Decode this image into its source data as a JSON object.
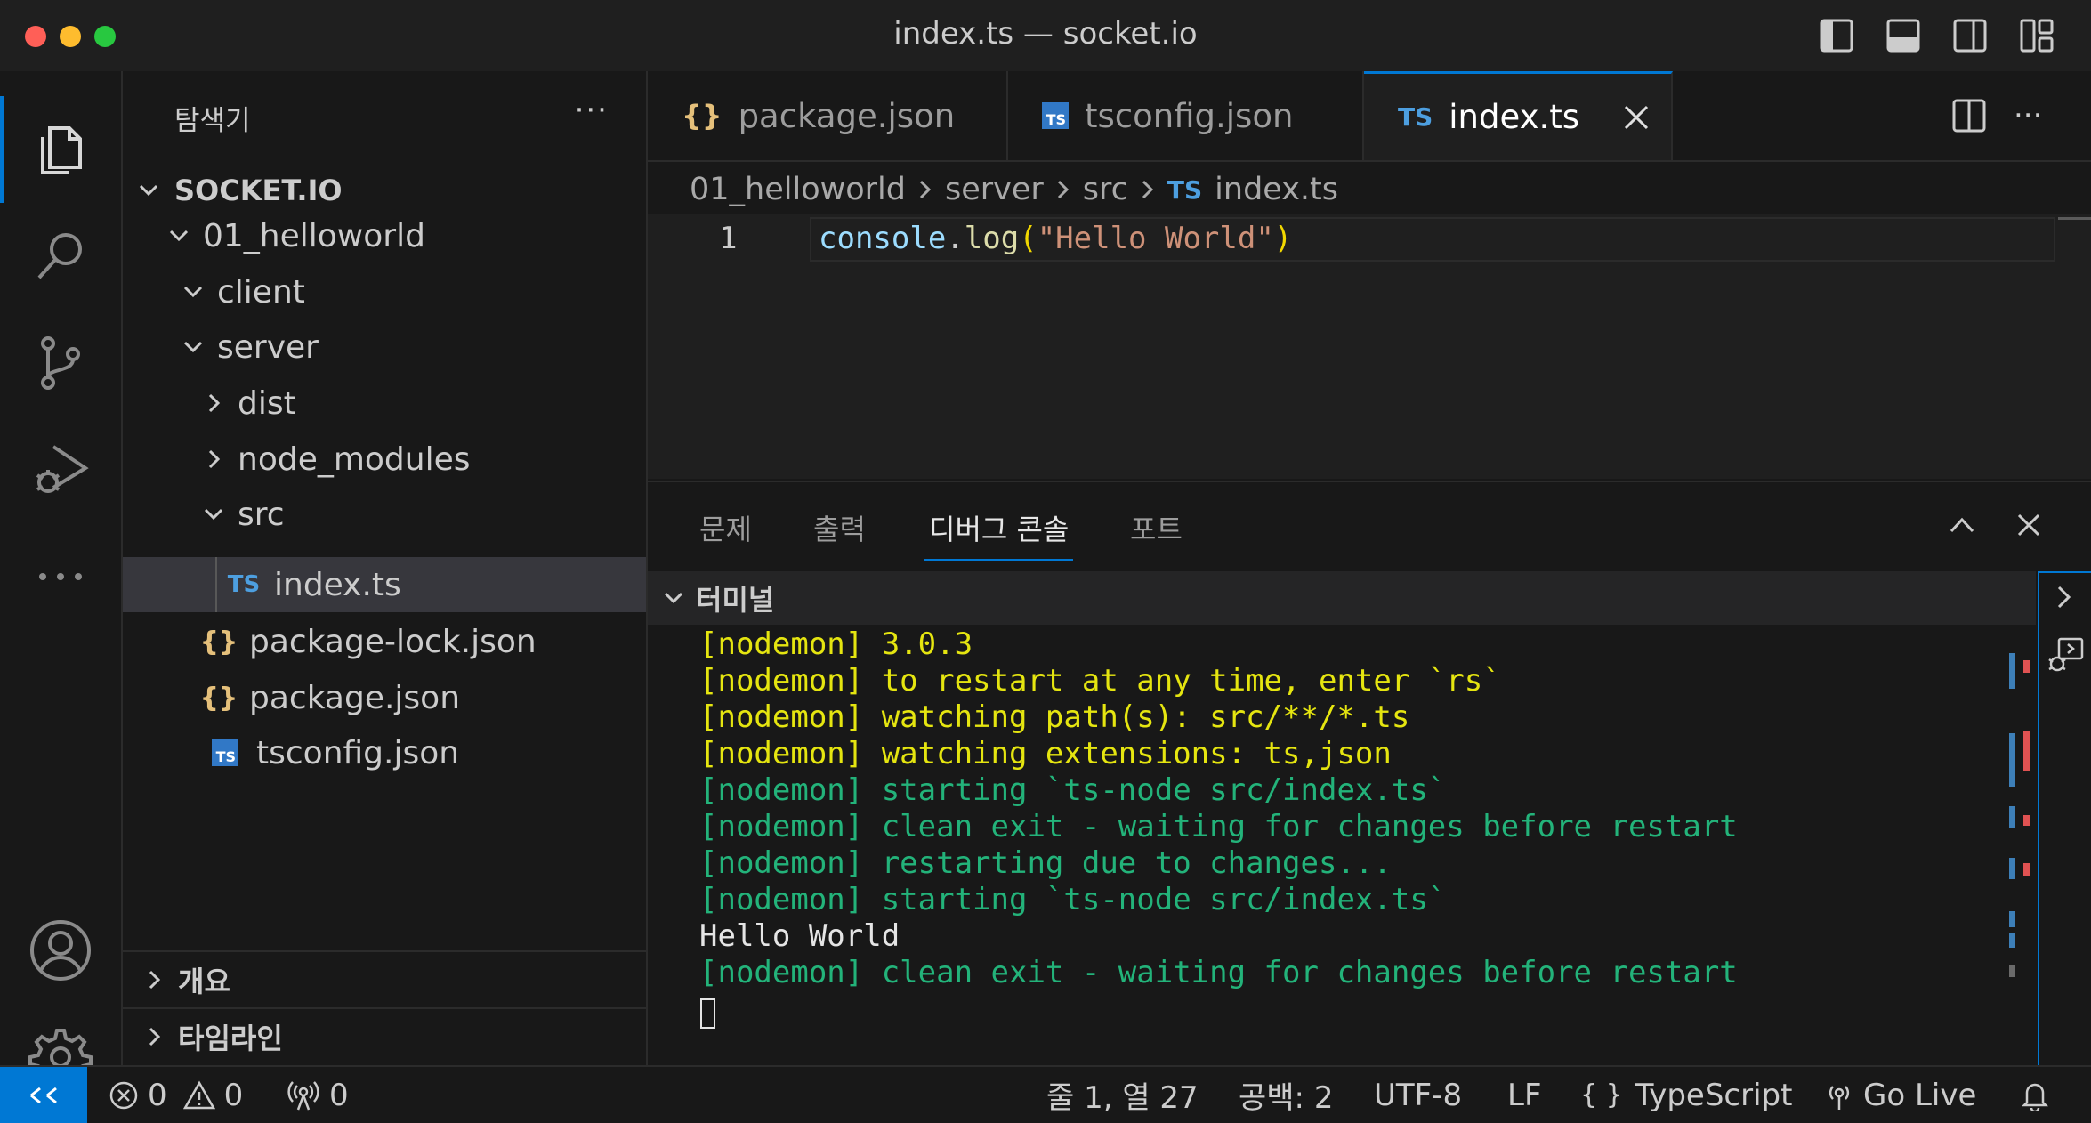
{
  "window": {
    "title": "index.ts — socket.io"
  },
  "sidebar": {
    "title": "탐색기",
    "more_label": "···",
    "root": "SOCKET.IO",
    "tree": [
      {
        "label": "01_helloworld",
        "kind": "folder-open"
      },
      {
        "label": "client",
        "kind": "folder-open"
      },
      {
        "label": "server",
        "kind": "folder-open"
      },
      {
        "label": "dist",
        "kind": "folder-closed"
      },
      {
        "label": "node_modules",
        "kind": "folder-closed"
      },
      {
        "label": "src",
        "kind": "folder-open"
      },
      {
        "label": "index.ts",
        "kind": "file-ts",
        "selected": true
      },
      {
        "label": "package-lock.json",
        "kind": "file-json"
      },
      {
        "label": "package.json",
        "kind": "file-json"
      },
      {
        "label": "tsconfig.json",
        "kind": "file-tsconfig"
      }
    ],
    "sections": {
      "outline": "개요",
      "timeline": "타임라인"
    }
  },
  "tabs": [
    {
      "label": "package.json",
      "icon_text": "{}"
    },
    {
      "label": "tsconfig.json",
      "icon_text": "TS"
    },
    {
      "label": "index.ts",
      "icon_text": "TS",
      "active": true
    }
  ],
  "breadcrumb": {
    "items": [
      "01_helloworld",
      "server",
      "src",
      "index.ts"
    ],
    "ts_icon": "TS"
  },
  "editor": {
    "line_number": "1",
    "code": {
      "object": "console",
      "dot": ".",
      "method": "log",
      "open": "(",
      "string": "\"Hello World\"",
      "close": ")"
    }
  },
  "panel": {
    "tabs": [
      "문제",
      "출력",
      "디버그 콘솔",
      "포트"
    ],
    "active_tab": "디버그 콘솔",
    "terminal_title": "터미널",
    "lines": [
      {
        "text": "[nodemon] 3.0.3",
        "color": "yellow"
      },
      {
        "text": "[nodemon] to restart at any time, enter `rs`",
        "color": "yellow"
      },
      {
        "text": "[nodemon] watching path(s): src/**/*.ts",
        "color": "yellow"
      },
      {
        "text": "[nodemon] watching extensions: ts,json",
        "color": "yellow"
      },
      {
        "text": "[nodemon] starting `ts-node src/index.ts`",
        "color": "green"
      },
      {
        "text": "[nodemon] clean exit - waiting for changes before restart",
        "color": "green"
      },
      {
        "text": "[nodemon] restarting due to changes...",
        "color": "green"
      },
      {
        "text": "[nodemon] starting `ts-node src/index.ts`",
        "color": "green"
      },
      {
        "text": "Hello World",
        "color": "white"
      },
      {
        "text": "[nodemon] clean exit - waiting for changes before restart",
        "color": "green"
      }
    ]
  },
  "statusbar": {
    "errors": "0",
    "warnings": "0",
    "ports": "0",
    "cursor": "줄 1, 열 27",
    "spaces": "공백: 2",
    "encoding": "UTF-8",
    "eol": "LF",
    "language": "TypeScript",
    "language_icon": "{ }",
    "golive": "Go Live"
  },
  "colors": {
    "accent": "#0078d4",
    "terminal_yellow": "#e5e510",
    "terminal_green": "#23b37a",
    "ts_blue": "#4d9fe0",
    "json_yellow": "#e5c07b"
  }
}
